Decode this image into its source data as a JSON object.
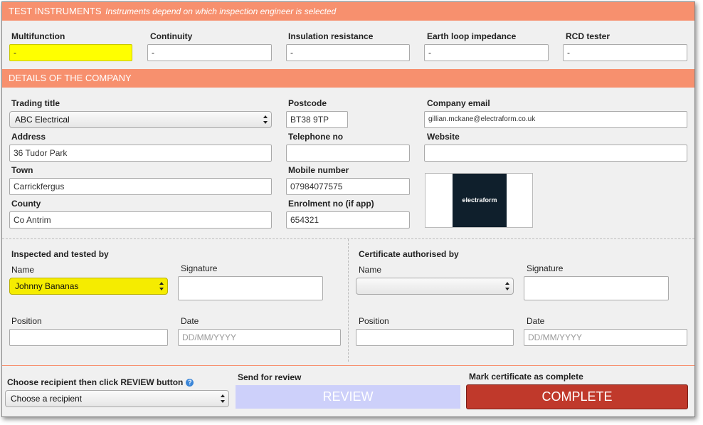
{
  "test_instruments": {
    "title": "TEST INSTRUMENTS",
    "subtitle": "Instruments depend on which inspection engineer is selected",
    "fields": [
      {
        "label": "Multifunction",
        "value": "-"
      },
      {
        "label": "Continuity",
        "value": "-"
      },
      {
        "label": "Insulation resistance",
        "value": "-"
      },
      {
        "label": "Earth loop impedance",
        "value": "-"
      },
      {
        "label": "RCD tester",
        "value": "-"
      }
    ]
  },
  "company": {
    "title": "DETAILS OF THE COMPANY",
    "trading_title_label": "Trading title",
    "trading_title_value": "ABC Electrical",
    "address_label": "Address",
    "address_value": "36 Tudor Park",
    "town_label": "Town",
    "town_value": "Carrickfergus",
    "county_label": "County",
    "county_value": "Co Antrim",
    "postcode_label": "Postcode",
    "postcode_value": "BT38 9TP",
    "telephone_label": "Telephone no",
    "telephone_value": "",
    "mobile_label": "Mobile number",
    "mobile_value": "07984077575",
    "enrolment_label": "Enrolment no (if app)",
    "enrolment_value": "654321",
    "email_label": "Company email",
    "email_value": "gillian.mckane@electraform.co.uk",
    "website_label": "Website",
    "website_value": "",
    "logo_text": "electraform"
  },
  "inspected": {
    "title": "Inspected and tested by",
    "name_label": "Name",
    "name_value": "Johnny Bananas",
    "signature_label": "Signature",
    "position_label": "Position",
    "position_value": "",
    "date_label": "Date",
    "date_placeholder": "DD/MM/YYYY"
  },
  "authorised": {
    "title": "Certificate authorised by",
    "name_label": "Name",
    "name_value": "",
    "signature_label": "Signature",
    "position_label": "Position",
    "position_value": "",
    "date_label": "Date",
    "date_placeholder": "DD/MM/YYYY"
  },
  "footer": {
    "recipient_label": "Choose recipient then click REVIEW button",
    "help_icon": "?",
    "recipient_value": "Choose a recipient",
    "review_label": "Send for review",
    "review_button": "REVIEW",
    "complete_label": "Mark certificate as complete",
    "complete_button": "COMPLETE"
  },
  "colors": {
    "band": "#f7906e",
    "highlight": "#ffff00",
    "review_button": "#cdd0fa",
    "complete_button": "#c0392b"
  }
}
